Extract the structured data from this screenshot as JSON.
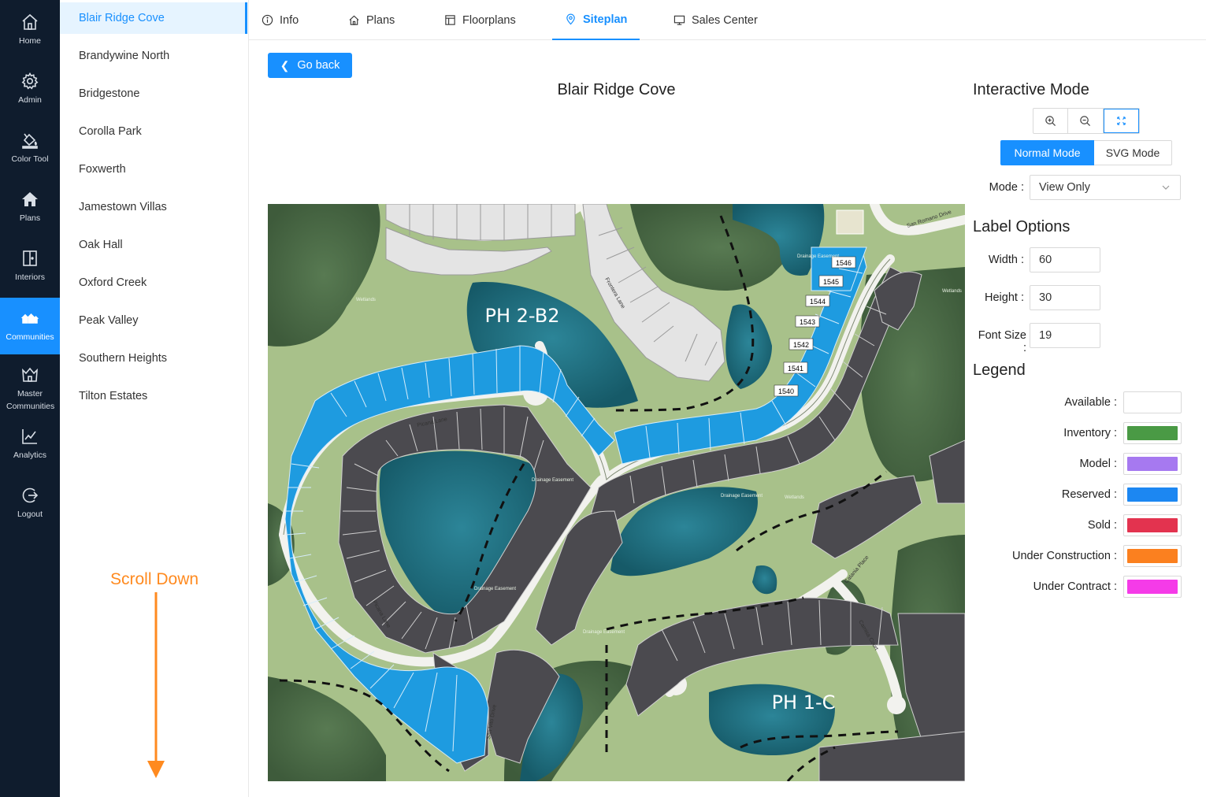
{
  "nav": [
    {
      "label": "Home",
      "icon": "home-icon"
    },
    {
      "label": "Admin",
      "icon": "gear-icon"
    },
    {
      "label": "Color Tool",
      "icon": "paint-bucket-icon"
    },
    {
      "label": "Plans",
      "icon": "house-icon"
    },
    {
      "label": "Interiors",
      "icon": "door-icon"
    },
    {
      "label": "Communities",
      "icon": "community-icon",
      "active": true
    },
    {
      "label": "Master Communities",
      "icon": "crown-house-icon"
    },
    {
      "label": "Analytics",
      "icon": "chart-icon"
    },
    {
      "label": "Logout",
      "icon": "logout-icon"
    }
  ],
  "communities": [
    "Blair Ridge Cove",
    "Brandywine North",
    "Bridgestone",
    "Corolla Park",
    "Foxwerth",
    "Jamestown Villas",
    "Oak Hall",
    "Oxford Creek",
    "Peak Valley",
    "Southern Heights",
    "Tilton Estates"
  ],
  "active_community": "Blair Ridge Cove",
  "scroll_hint": "Scroll Down",
  "tabs": [
    {
      "label": "Info",
      "icon": "info-icon"
    },
    {
      "label": "Plans",
      "icon": "home-icon"
    },
    {
      "label": "Floorplans",
      "icon": "floorplan-icon"
    },
    {
      "label": "Siteplan",
      "icon": "location-pin-icon",
      "active": true
    },
    {
      "label": "Sales Center",
      "icon": "monitor-icon"
    }
  ],
  "go_back": "Go back",
  "page_title": "Blair Ridge Cove",
  "map": {
    "phase_labels": [
      "PH 2-B2",
      "PH 1-C"
    ],
    "lot_labels": [
      "1546",
      "1545",
      "1544",
      "1543",
      "1542",
      "1541",
      "1540"
    ],
    "street_labels": [
      "Picana Lane",
      "Frontera Lane",
      "San Vito Drive",
      "San Romano Drive",
      "Picana Lane",
      "Catania Place",
      "Camisa Court"
    ],
    "area_labels": [
      "Wetlands",
      "Wetlands",
      "Wetlands",
      "Drainage Easement",
      "Drainage Easement",
      "Drainage Easement",
      "Drainage Easement",
      "Drainage Easement"
    ]
  },
  "interactive_mode": {
    "title": "Interactive Mode",
    "zoom_buttons": [
      "zoom-in-icon",
      "zoom-out-icon",
      "fit-screen-icon"
    ],
    "modes": [
      "Normal Mode",
      "SVG Mode"
    ],
    "active_mode": "Normal Mode",
    "mode_label": "Mode",
    "mode_value": "View Only"
  },
  "label_options": {
    "title": "Label Options",
    "width_label": "Width",
    "width_value": "60",
    "height_label": "Height",
    "height_value": "30",
    "font_size_label": "Font Size",
    "font_size_value": "19"
  },
  "legend": {
    "title": "Legend",
    "items": [
      {
        "label": "Available",
        "color": "#ffffff"
      },
      {
        "label": "Inventory",
        "color": "#4a9a45"
      },
      {
        "label": "Model",
        "color": "#a679f0"
      },
      {
        "label": "Reserved",
        "color": "#1c87f2"
      },
      {
        "label": "Sold",
        "color": "#e3334f"
      },
      {
        "label": "Under Construction",
        "color": "#fb801f"
      },
      {
        "label": "Under Contract",
        "color": "#f53be8"
      }
    ]
  },
  "colors": {
    "nav_bg": "#0f1c2d",
    "accent": "#1890ff",
    "map_grass": "#a9c28a",
    "map_water": "#1f6f80",
    "map_forest": "#4d6b48",
    "lot_sold_grey": "#4b4a4f",
    "lot_available": "#e6e6e6",
    "lot_reserved": "#1e9be0"
  }
}
